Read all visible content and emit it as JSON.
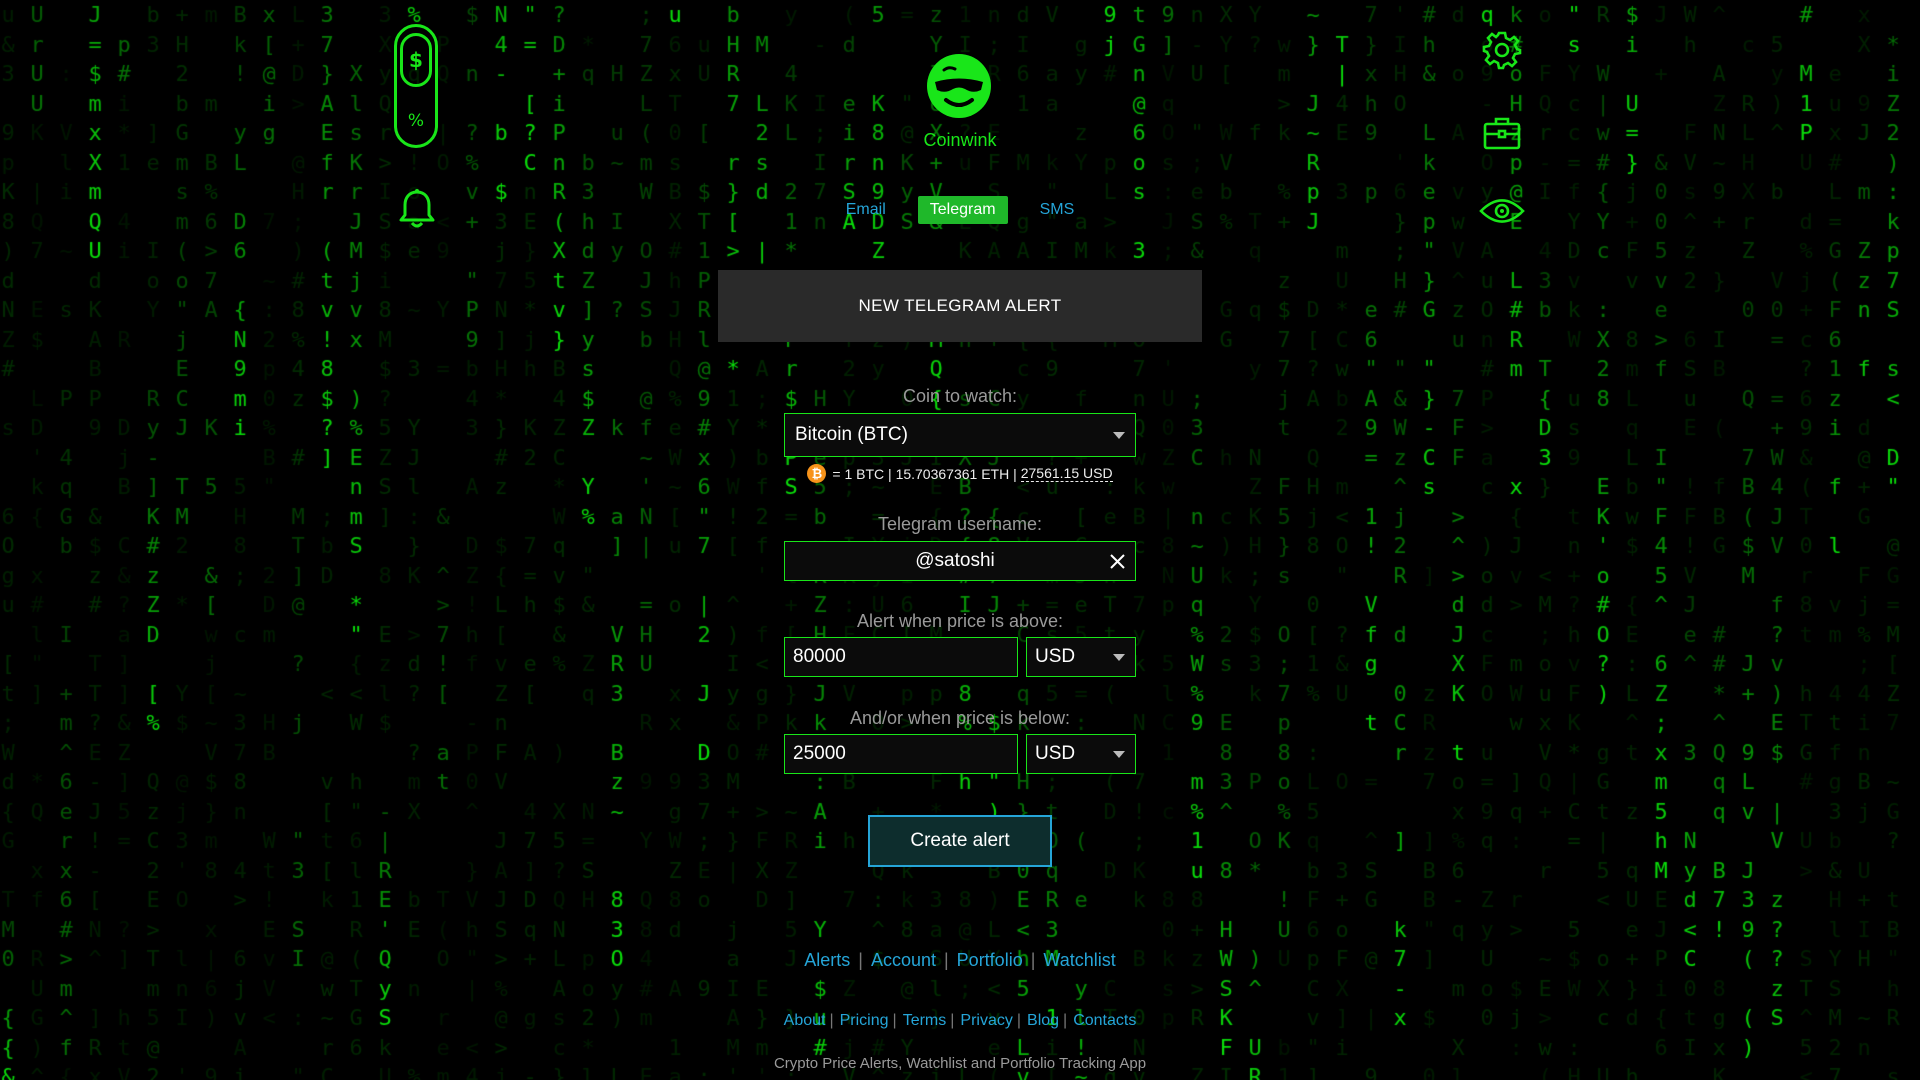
{
  "brand": {
    "name": "Coinwink",
    "color": "#19e619"
  },
  "left_icons": {
    "toggle_top": "$",
    "toggle_bottom": "%",
    "bell": "bell-icon"
  },
  "right_icons": [
    "gear-icon",
    "briefcase-icon",
    "eye-icon"
  ],
  "tabs": [
    {
      "label": "Email",
      "active": false
    },
    {
      "label": "Telegram",
      "active": true
    },
    {
      "label": "SMS",
      "active": false
    }
  ],
  "panel": {
    "title": "NEW TELEGRAM ALERT"
  },
  "form": {
    "coin_label": "Coin to watch:",
    "coin_value": "Bitcoin (BTC)",
    "rate_coin_symbol": "₿",
    "rate_text": "= 1 BTC | 15.70367361 ETH |",
    "rate_usd": "27561.15 USD",
    "username_label": "Telegram username:",
    "username_value": "@satoshi",
    "above_label": "Alert when price is above:",
    "above_value": "80000",
    "above_currency": "USD",
    "below_label": "And/or when price is below:",
    "below_value": "25000",
    "below_currency": "USD",
    "submit_label": "Create alert"
  },
  "footer_nav": [
    "Alerts",
    "Account",
    "Portfolio",
    "Watchlist"
  ],
  "footer_links": [
    "About",
    "Pricing",
    "Terms",
    "Privacy",
    "Blog",
    "Contacts"
  ],
  "tagline": "Crypto Price Alerts, Watchlist and Portfolio Tracking App",
  "colors": {
    "accent_green": "#19e619",
    "link_blue": "#25a5d8",
    "panel_bg": "#2a2a2a",
    "btc_orange": "#f7931a"
  }
}
